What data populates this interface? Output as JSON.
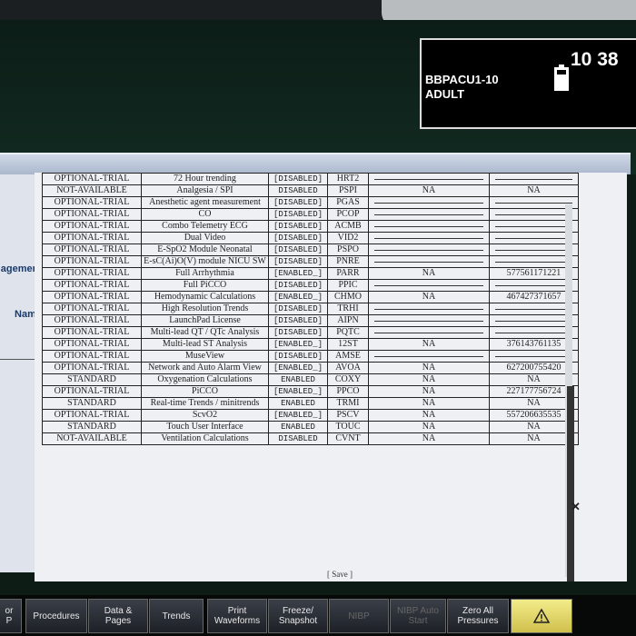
{
  "header": {
    "bed": "BBPACU1-10",
    "patient_type": "ADULT",
    "time": "10 38"
  },
  "left_labels": {
    "management": "agement",
    "name": "Name"
  },
  "table": {
    "rows": [
      [
        "OPTIONAL-TRIAL",
        "72 Hour trending",
        "[DISABLED]",
        "HRT2",
        "",
        ""
      ],
      [
        "NOT-AVAILABLE",
        "Analgesia / SPI",
        "DISABLED",
        "PSPI",
        "NA",
        "NA"
      ],
      [
        "OPTIONAL-TRIAL",
        "Anesthetic agent measurement",
        "[DISABLED]",
        "PGAS",
        "",
        ""
      ],
      [
        "OPTIONAL-TRIAL",
        "CO",
        "[DISABLED]",
        "PCOP",
        "",
        ""
      ],
      [
        "OPTIONAL-TRIAL",
        "Combo Telemetry ECG",
        "[DISABLED]",
        "ACMB",
        "",
        ""
      ],
      [
        "OPTIONAL-TRIAL",
        "Dual Video",
        "[DISABLED]",
        "VID2",
        "",
        ""
      ],
      [
        "OPTIONAL-TRIAL",
        "E-SpO2 Module Neonatal",
        "[DISABLED]",
        "PSPO",
        "",
        ""
      ],
      [
        "OPTIONAL-TRIAL",
        "E-sC(Ai)O(V) module NICU SW",
        "[DISABLED]",
        "PNRE",
        "",
        ""
      ],
      [
        "OPTIONAL-TRIAL",
        "Full Arrhythmia",
        "[ENABLED_]",
        "PARR",
        "NA",
        "577561171221"
      ],
      [
        "OPTIONAL-TRIAL",
        "Full PiCCO",
        "[DISABLED]",
        "PPIC",
        "",
        ""
      ],
      [
        "OPTIONAL-TRIAL",
        "Hemodynamic Calculations",
        "[ENABLED_]",
        "CHMO",
        "NA",
        "467427371657"
      ],
      [
        "OPTIONAL-TRIAL",
        "High Resolution Trends",
        "[DISABLED]",
        "TRHI",
        "",
        ""
      ],
      [
        "OPTIONAL-TRIAL",
        "LaunchPad License",
        "[DISABLED]",
        "AIPN",
        "",
        ""
      ],
      [
        "OPTIONAL-TRIAL",
        "Multi-lead QT / QTc Analysis",
        "[DISABLED]",
        "PQTC",
        "",
        ""
      ],
      [
        "OPTIONAL-TRIAL",
        "Multi-lead ST Analysis",
        "[ENABLED_]",
        "12ST",
        "NA",
        "376143761135"
      ],
      [
        "OPTIONAL-TRIAL",
        "MuseView",
        "[DISABLED]",
        "AMSE",
        "",
        ""
      ],
      [
        "OPTIONAL-TRIAL",
        "Network and Auto Alarm View",
        "[ENABLED_]",
        "AVOA",
        "NA",
        "627200755420"
      ],
      [
        "STANDARD",
        "Oxygenation Calculations",
        "ENABLED",
        "COXY",
        "NA",
        "NA"
      ],
      [
        "OPTIONAL-TRIAL",
        "PiCCO",
        "[ENABLED_]",
        "PPCO",
        "NA",
        "227177756724"
      ],
      [
        "STANDARD",
        "Real-time Trends / minitrends",
        "ENABLED",
        "TRMI",
        "NA",
        "NA"
      ],
      [
        "OPTIONAL-TRIAL",
        "ScvO2",
        "[ENABLED_]",
        "PSCV",
        "NA",
        "557206635535"
      ],
      [
        "STANDARD",
        "Touch User Interface",
        "ENABLED",
        "TOUC",
        "NA",
        "NA"
      ],
      [
        "NOT-AVAILABLE",
        "Ventilation Calculations",
        "DISABLED",
        "CVNT",
        "NA",
        "NA"
      ]
    ],
    "save_label": "[ Save ]"
  },
  "toolbar": {
    "b0": "or\nP",
    "b1": "Procedures",
    "b2": "Data &\nPages",
    "b3": "Trends",
    "b4": "Print\nWaveforms",
    "b5": "Freeze/\nSnapshot",
    "b6": "NIBP",
    "b7": "NIBP Auto\nStart",
    "b8": "Zero All\nPressures",
    "alarm_icon": "alarm-triangle-icon",
    "alarm_color": "#e6dc6e"
  }
}
